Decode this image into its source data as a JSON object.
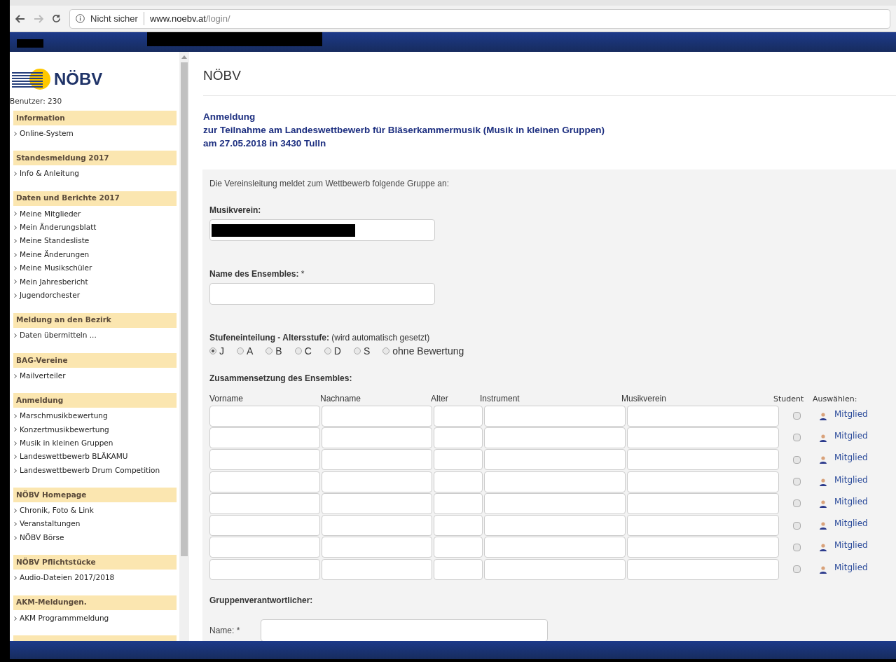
{
  "browser": {
    "security_label": "Nicht sicher",
    "url_host": "www.noebv.at",
    "url_path": "/login/"
  },
  "sidebar": {
    "logo_text": "NÖBV",
    "user": "Benutzer: 230",
    "sections": [
      {
        "heading": "Information",
        "items": [
          "Online-System"
        ]
      },
      {
        "heading": "Standesmeldung 2017",
        "items": [
          "Info & Anleitung"
        ]
      },
      {
        "heading": "Daten und Berichte 2017",
        "items": [
          "Meine Mitglieder",
          "Mein Änderungsblatt",
          "Meine Standesliste",
          "Meine Änderungen",
          "Meine Musikschüler",
          "Mein Jahresbericht",
          "Jugendorchester"
        ]
      },
      {
        "heading": "Meldung an den Bezirk",
        "items": [
          "Daten übermitteln ..."
        ]
      },
      {
        "heading": "BAG-Vereine",
        "items": [
          "Mailverteiler"
        ]
      },
      {
        "heading": "Anmeldung",
        "items": [
          "Marschmusikbewertung",
          "Konzertmusikbewertung",
          "Musik in kleinen Gruppen",
          "Landeswettbewerb BLÄKAMU",
          "Landeswettbewerb Drum Competition"
        ]
      },
      {
        "heading": "NÖBV Homepage",
        "items": [
          "Chronik, Foto & Link",
          "Veranstaltungen",
          "NÖBV Börse"
        ]
      },
      {
        "heading": "NÖBV Pflichtstücke",
        "items": [
          "Audio-Dateien 2017/2018"
        ]
      },
      {
        "heading": "AKM-Meldungen.",
        "items": [
          "AKM Programmmeldung"
        ]
      }
    ]
  },
  "main": {
    "title": "NÖBV",
    "heading_lines": [
      "Anmeldung",
      "zur Teilnahme am Landeswettbewerb für Bläserkammermusik (Musik in kleinen Gruppen)",
      "am 27.05.2018 in 3430 Tulln"
    ],
    "intro": "Die Vereinsleitung meldet zum Wettbewerb folgende Gruppe an:",
    "musikverein_label": "Musikverein:",
    "ensemble_label": "Name des Ensembles:",
    "ensemble_required": "*",
    "level_label": "Stufeneinteilung - Altersstufe:",
    "level_hint": "(wird automatisch gesetzt)",
    "level_options": [
      {
        "label": "J",
        "selected": true
      },
      {
        "label": "A",
        "selected": false
      },
      {
        "label": "B",
        "selected": false
      },
      {
        "label": "C",
        "selected": false
      },
      {
        "label": "D",
        "selected": false
      },
      {
        "label": "S",
        "selected": false
      },
      {
        "label": "ohne Bewertung",
        "selected": false
      }
    ],
    "members_label": "Zusammensetzung des Ensembles:",
    "columns": [
      "Vorname",
      "Nachname",
      "Alter",
      "Instrument",
      "Musikverein",
      "Student",
      "Auswählen:"
    ],
    "rows": [
      {
        "student": false,
        "link": "Mitglied"
      },
      {
        "student": false,
        "link": "Mitglied"
      },
      {
        "student": false,
        "link": "Mitglied"
      },
      {
        "student": false,
        "link": "Mitglied"
      },
      {
        "student": false,
        "link": "Mitglied"
      },
      {
        "student": false,
        "link": "Mitglied"
      },
      {
        "student": false,
        "link": "Mitglied"
      },
      {
        "student": false,
        "link": "Mitglied"
      }
    ],
    "responsible_label": "Gruppenverantwortlicher:",
    "name_label": "Name:",
    "name_required": "*"
  }
}
